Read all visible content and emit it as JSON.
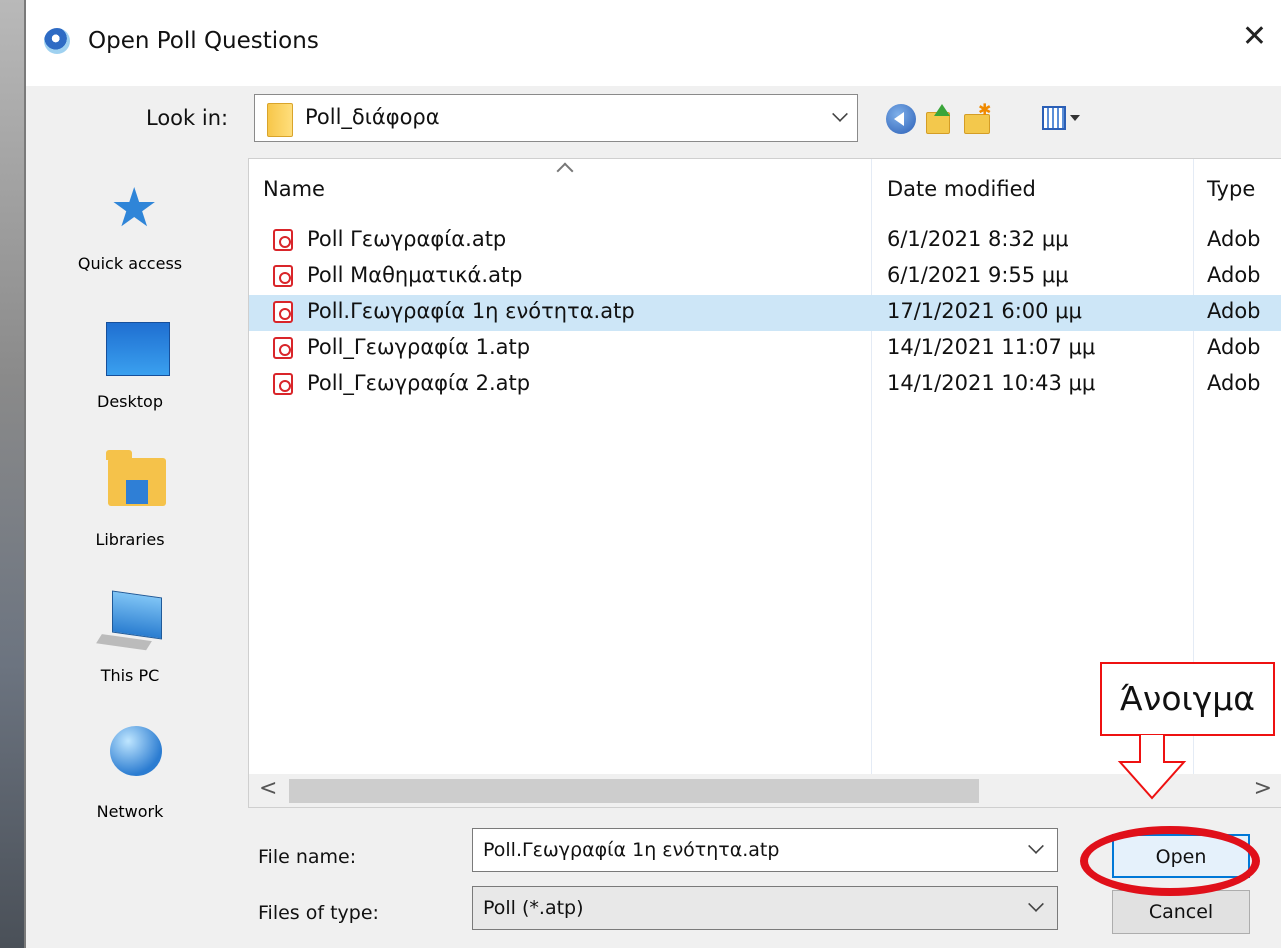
{
  "window": {
    "title": "Open Poll Questions",
    "close_glyph": "✕"
  },
  "lookin": {
    "label": "Look in:",
    "value": "Poll_διάφορα"
  },
  "places": [
    {
      "label": "Quick access",
      "icon": "quick-access-icon"
    },
    {
      "label": "Desktop",
      "icon": "desktop-icon"
    },
    {
      "label": "Libraries",
      "icon": "libraries-icon"
    },
    {
      "label": "This PC",
      "icon": "this-pc-icon"
    },
    {
      "label": "Network",
      "icon": "network-icon"
    }
  ],
  "columns": {
    "name": "Name",
    "date": "Date modified",
    "type": "Type"
  },
  "files": [
    {
      "name": "Poll Γεωγραφία.atp",
      "date": "6/1/2021 8:32 μμ",
      "type": "Adob",
      "selected": false
    },
    {
      "name": "Poll Μαθηματικά.atp",
      "date": "6/1/2021 9:55 μμ",
      "type": "Adob",
      "selected": false
    },
    {
      "name": "Poll.Γεωγραφία 1η ενότητα.atp",
      "date": "17/1/2021 6:00 μμ",
      "type": "Adob",
      "selected": true
    },
    {
      "name": "Poll_Γεωγραφία 1.atp",
      "date": "14/1/2021 11:07 μμ",
      "type": "Adob",
      "selected": false
    },
    {
      "name": "Poll_Γεωγραφία 2.atp",
      "date": "14/1/2021 10:43 μμ",
      "type": "Adob",
      "selected": false
    }
  ],
  "filename": {
    "label": "File name:",
    "value": "Poll.Γεωγραφία 1η ενότητα.atp"
  },
  "filetype": {
    "label": "Files of type:",
    "value": "Poll (*.atp)"
  },
  "buttons": {
    "open": "Open",
    "cancel": "Cancel"
  },
  "annotation": {
    "callout_text": "Άνοιγμα",
    "color": "#e0101a"
  },
  "scroll": {
    "left": "<",
    "right": ">"
  }
}
